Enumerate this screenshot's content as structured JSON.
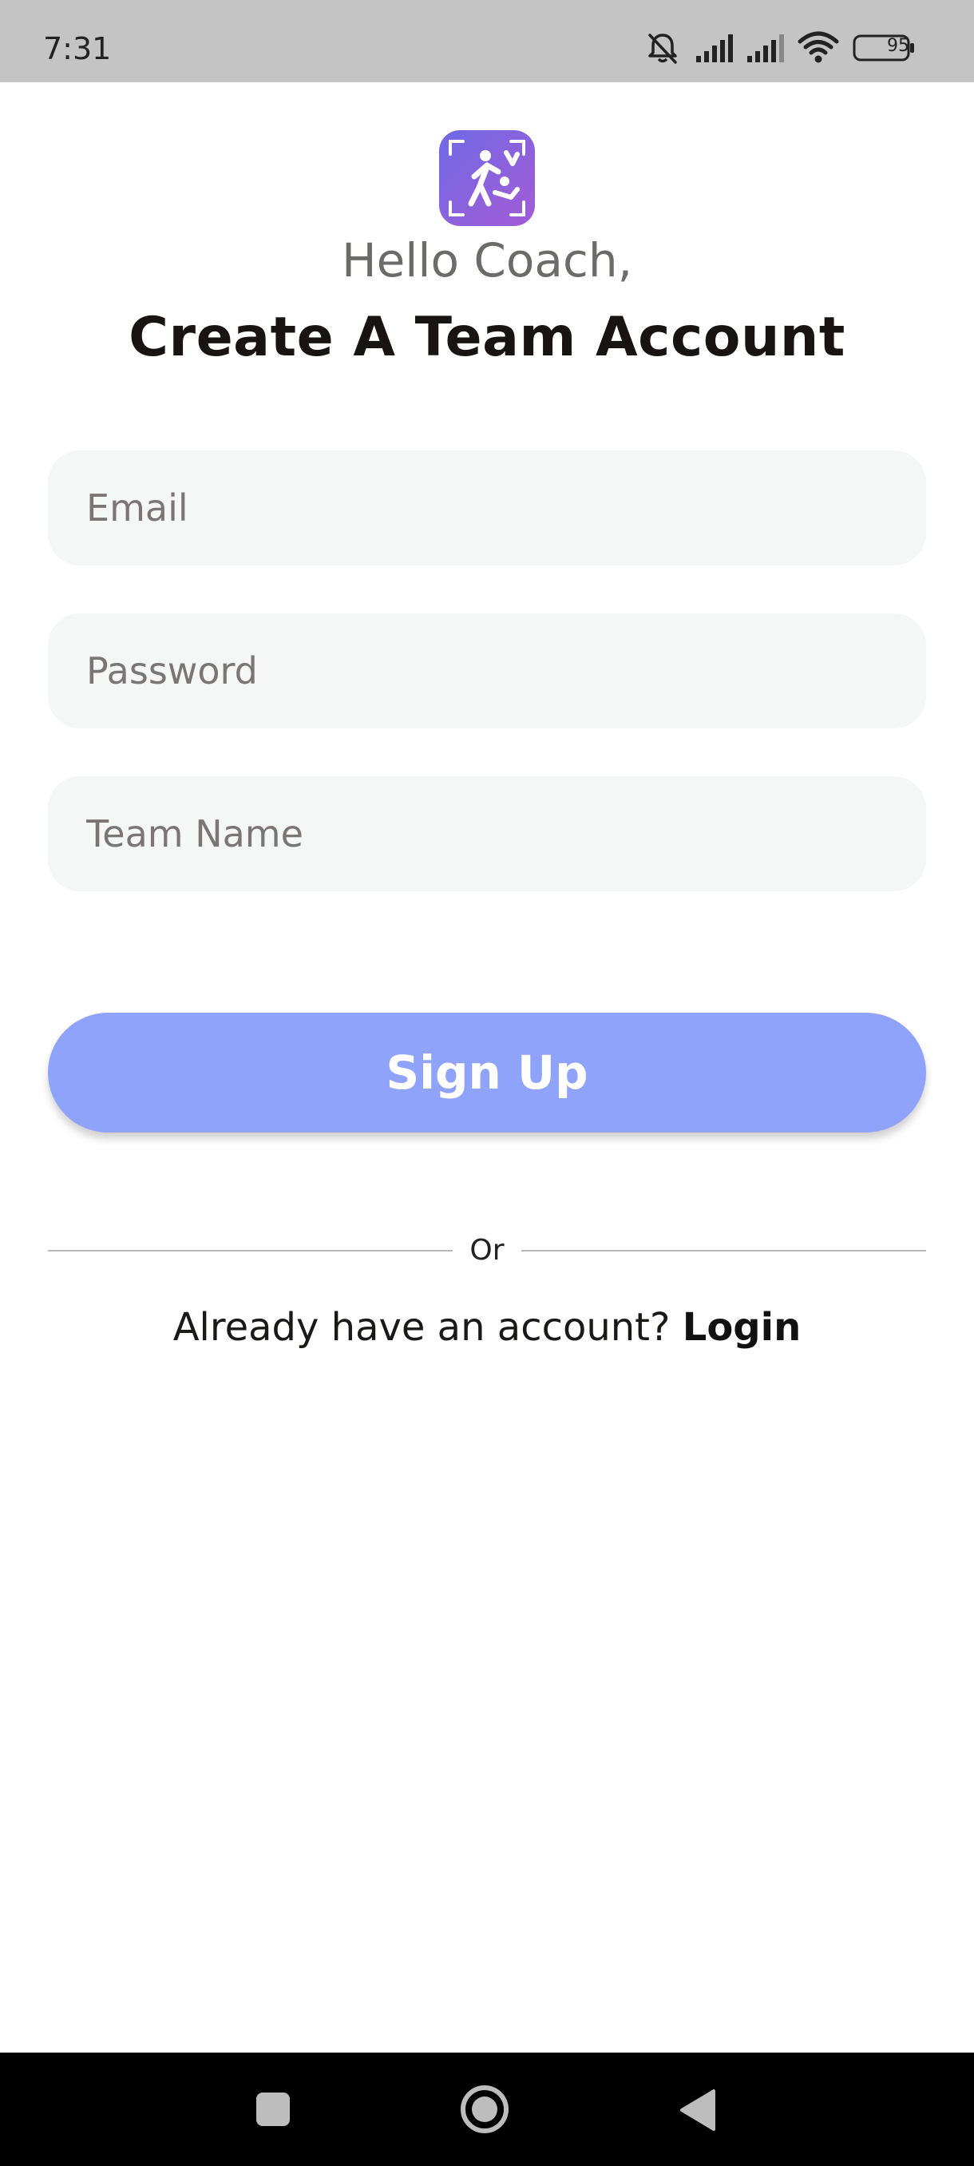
{
  "status_bar": {
    "time": "7:31",
    "battery": "95",
    "icons": [
      "bell-off-icon",
      "signal-icon",
      "signal-icon",
      "wifi-icon",
      "battery-icon"
    ]
  },
  "header": {
    "logo_icon": "app-logo-icon",
    "greeting": "Hello Coach,",
    "title": "Create A Team Account"
  },
  "form": {
    "email_placeholder": "Email",
    "email_value": "",
    "password_placeholder": "Password",
    "password_value": "",
    "team_name_placeholder": "Team Name",
    "team_name_value": "",
    "submit_label": "Sign Up"
  },
  "divider": {
    "label": "Or"
  },
  "login_prompt": {
    "text": "Already have an account? ",
    "link_label": "Login"
  },
  "nav_bar": {
    "buttons": [
      "recents-square-icon",
      "home-circle-icon",
      "back-triangle-icon"
    ]
  },
  "colors": {
    "accent": "#90a3fa",
    "field_background": "#f5f6f6",
    "status_bar": "#c4c4c4",
    "logo_gradient_start": "#6f6ae6",
    "logo_gradient_end": "#a25bd6"
  }
}
